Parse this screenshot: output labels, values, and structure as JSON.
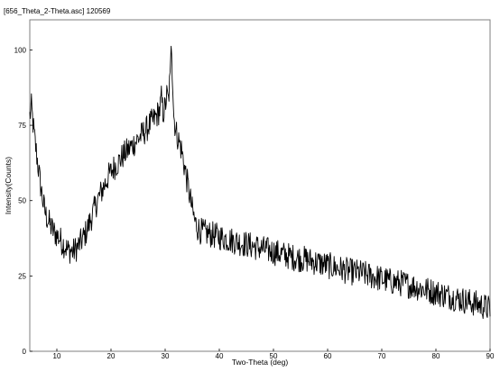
{
  "window": {
    "title": "[656_Theta_2-Theta.asc] 120569"
  },
  "chart_data": {
    "type": "line",
    "title": "",
    "xlabel": "Two-Theta (deg)",
    "ylabel": "Intensity(Counts)",
    "xlim": [
      5,
      90
    ],
    "ylim": [
      0,
      110
    ],
    "x_ticks": [
      10,
      20,
      30,
      40,
      50,
      60,
      70,
      80,
      90
    ],
    "y_ticks": [
      0,
      25,
      50,
      75,
      100
    ],
    "grid": false,
    "legend": "none",
    "line_color": "#000000",
    "noise_amplitude": 4.5,
    "series": [
      {
        "x": [
          5.0,
          5.3,
          5.8,
          6.5,
          7.0,
          7.5,
          8.0,
          8.5,
          9.0,
          9.5,
          10.0,
          10.5,
          11.0,
          11.5,
          12.0,
          12.5,
          13.0,
          13.5,
          14.0,
          14.5,
          15.0,
          15.5,
          16.0,
          16.5,
          17.0,
          17.5,
          18.0,
          18.5,
          19.0,
          19.5,
          20.0,
          20.5,
          21.0,
          21.5,
          22.0,
          22.5,
          23.0,
          23.5,
          24.0,
          24.5,
          25.0,
          25.5,
          26.0,
          26.5,
          27.0,
          27.5,
          28.0,
          28.5,
          29.0,
          29.3,
          29.6,
          30.0,
          30.3,
          30.6,
          30.9,
          31.1,
          31.3,
          31.6,
          32.0,
          32.5,
          33.0,
          33.5,
          34.0,
          34.5,
          35.0,
          35.5,
          36.0,
          36.5,
          37.0,
          38.0,
          39.0,
          40.0,
          41.0,
          42.0,
          43.0,
          44.0,
          45.0,
          46.0,
          47.0,
          48.0,
          50.0,
          52.0,
          54.0,
          56.0,
          58.0,
          60.0,
          62.0,
          64.0,
          66.0,
          68.0,
          70.0,
          72.0,
          74.0,
          76.0,
          78.0,
          80.0,
          82.0,
          84.0,
          86.0,
          88.0,
          90.0
        ],
        "y": [
          78,
          81,
          72,
          62,
          55,
          49,
          45,
          43,
          41,
          39.5,
          38.5,
          37.5,
          36,
          35,
          33.5,
          33.5,
          33,
          34,
          35,
          36.5,
          38,
          40,
          42.5,
          45,
          47.5,
          50,
          52,
          54,
          56,
          58,
          59.5,
          61,
          62,
          63,
          64.5,
          65.5,
          66.5,
          67.5,
          68.5,
          69.5,
          70.5,
          71.5,
          72.5,
          73.5,
          75,
          76,
          77,
          78.5,
          80,
          84,
          79,
          81,
          85,
          83,
          91,
          100,
          94,
          78,
          73,
          70,
          67,
          62,
          57,
          52,
          47,
          43,
          41,
          40,
          39.5,
          39,
          38.5,
          38,
          37.5,
          37,
          36.5,
          36,
          35.5,
          35,
          34.5,
          34,
          33,
          32,
          31,
          30.5,
          29.5,
          28.5,
          27.5,
          26.5,
          26,
          25,
          24,
          23,
          22.5,
          21.5,
          20.5,
          19.5,
          18.5,
          17.5,
          16.5,
          15.5,
          14
        ]
      }
    ]
  }
}
